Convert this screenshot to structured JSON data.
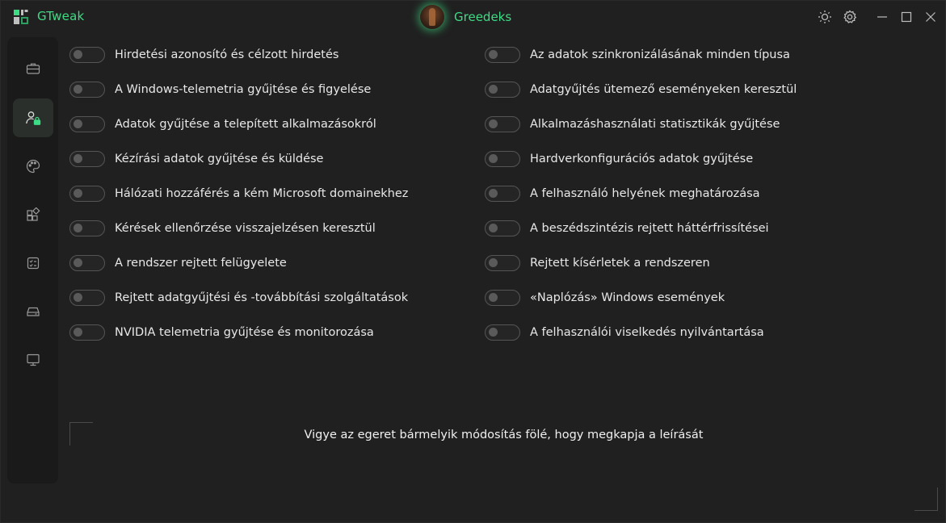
{
  "app": {
    "title": "GTweak",
    "username": "Greedeks"
  },
  "titlebar": {
    "icons": [
      "theme-sun-icon",
      "settings-gear-icon",
      "minimize-icon",
      "maximize-icon",
      "close-icon"
    ]
  },
  "sidebar": {
    "items": [
      {
        "icon": "briefcase-icon",
        "active": false
      },
      {
        "icon": "user-privacy-lock-icon",
        "active": true
      },
      {
        "icon": "palette-icon",
        "active": false
      },
      {
        "icon": "apps-icon",
        "active": false
      },
      {
        "icon": "checklist-icon",
        "active": false
      },
      {
        "icon": "drive-icon",
        "active": false
      },
      {
        "icon": "monitor-icon",
        "active": false
      }
    ]
  },
  "toggles": {
    "left": [
      {
        "label": "Hirdetési azonosító és célzott hirdetés",
        "on": false
      },
      {
        "label": "A Windows-telemetria gyűjtése és figyelése",
        "on": false
      },
      {
        "label": "Adatok gyűjtése a telepített alkalmazásokról",
        "on": false
      },
      {
        "label": "Kézírási adatok gyűjtése és küldése",
        "on": false
      },
      {
        "label": "Hálózati hozzáférés a kém Microsoft domainekhez",
        "on": false
      },
      {
        "label": "Kérések ellenőrzése visszajelzésen keresztül",
        "on": false
      },
      {
        "label": "A rendszer rejtett felügyelete",
        "on": false
      },
      {
        "label": "Rejtett adatgyűjtési és -továbbítási szolgáltatások",
        "on": false
      },
      {
        "label": "NVIDIA telemetria gyűjtése és monitorozása",
        "on": false
      }
    ],
    "right": [
      {
        "label": "Az adatok szinkronizálásának minden típusa",
        "on": false
      },
      {
        "label": "Adatgyűjtés ütemező eseményeken keresztül",
        "on": false
      },
      {
        "label": "Alkalmazáshasználati statisztikák gyűjtése",
        "on": false
      },
      {
        "label": "Hardverkonfigurációs adatok gyűjtése",
        "on": false
      },
      {
        "label": "A felhasználó helyének meghatározása",
        "on": false
      },
      {
        "label": "A beszédszintézis rejtett háttérfrissítései",
        "on": false
      },
      {
        "label": "Rejtett kísérletek a rendszeren",
        "on": false
      },
      {
        "label": "«Naplózás» Windows események",
        "on": false
      },
      {
        "label": "A felhasználói viselkedés nyilvántartása",
        "on": false
      }
    ]
  },
  "description": {
    "text": "Vigye az egeret bármelyik módosítás fölé, hogy megkapja a leírását"
  },
  "colors": {
    "accent": "#3ddc84",
    "background": "#202020",
    "sidebar": "#1a1a1a"
  }
}
